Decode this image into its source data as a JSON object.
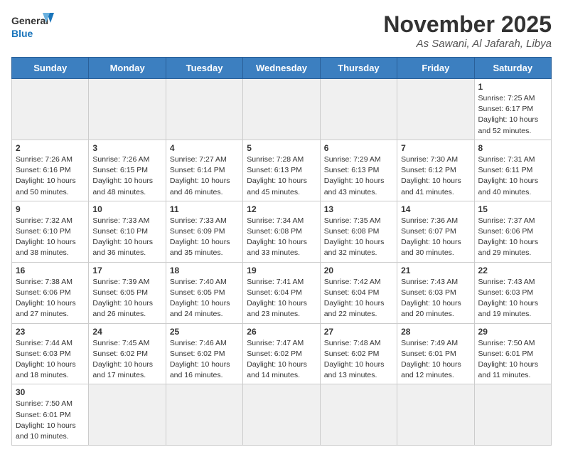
{
  "logo": {
    "general": "General",
    "blue": "Blue"
  },
  "title": "November 2025",
  "location": "As Sawani, Al Jafarah, Libya",
  "days_header": [
    "Sunday",
    "Monday",
    "Tuesday",
    "Wednesday",
    "Thursday",
    "Friday",
    "Saturday"
  ],
  "weeks": [
    [
      {
        "day": "",
        "info": ""
      },
      {
        "day": "",
        "info": ""
      },
      {
        "day": "",
        "info": ""
      },
      {
        "day": "",
        "info": ""
      },
      {
        "day": "",
        "info": ""
      },
      {
        "day": "",
        "info": ""
      },
      {
        "day": "1",
        "info": "Sunrise: 7:25 AM\nSunset: 6:17 PM\nDaylight: 10 hours and 52 minutes."
      }
    ],
    [
      {
        "day": "2",
        "info": "Sunrise: 7:26 AM\nSunset: 6:16 PM\nDaylight: 10 hours and 50 minutes."
      },
      {
        "day": "3",
        "info": "Sunrise: 7:26 AM\nSunset: 6:15 PM\nDaylight: 10 hours and 48 minutes."
      },
      {
        "day": "4",
        "info": "Sunrise: 7:27 AM\nSunset: 6:14 PM\nDaylight: 10 hours and 46 minutes."
      },
      {
        "day": "5",
        "info": "Sunrise: 7:28 AM\nSunset: 6:13 PM\nDaylight: 10 hours and 45 minutes."
      },
      {
        "day": "6",
        "info": "Sunrise: 7:29 AM\nSunset: 6:13 PM\nDaylight: 10 hours and 43 minutes."
      },
      {
        "day": "7",
        "info": "Sunrise: 7:30 AM\nSunset: 6:12 PM\nDaylight: 10 hours and 41 minutes."
      },
      {
        "day": "8",
        "info": "Sunrise: 7:31 AM\nSunset: 6:11 PM\nDaylight: 10 hours and 40 minutes."
      }
    ],
    [
      {
        "day": "9",
        "info": "Sunrise: 7:32 AM\nSunset: 6:10 PM\nDaylight: 10 hours and 38 minutes."
      },
      {
        "day": "10",
        "info": "Sunrise: 7:33 AM\nSunset: 6:10 PM\nDaylight: 10 hours and 36 minutes."
      },
      {
        "day": "11",
        "info": "Sunrise: 7:33 AM\nSunset: 6:09 PM\nDaylight: 10 hours and 35 minutes."
      },
      {
        "day": "12",
        "info": "Sunrise: 7:34 AM\nSunset: 6:08 PM\nDaylight: 10 hours and 33 minutes."
      },
      {
        "day": "13",
        "info": "Sunrise: 7:35 AM\nSunset: 6:08 PM\nDaylight: 10 hours and 32 minutes."
      },
      {
        "day": "14",
        "info": "Sunrise: 7:36 AM\nSunset: 6:07 PM\nDaylight: 10 hours and 30 minutes."
      },
      {
        "day": "15",
        "info": "Sunrise: 7:37 AM\nSunset: 6:06 PM\nDaylight: 10 hours and 29 minutes."
      }
    ],
    [
      {
        "day": "16",
        "info": "Sunrise: 7:38 AM\nSunset: 6:06 PM\nDaylight: 10 hours and 27 minutes."
      },
      {
        "day": "17",
        "info": "Sunrise: 7:39 AM\nSunset: 6:05 PM\nDaylight: 10 hours and 26 minutes."
      },
      {
        "day": "18",
        "info": "Sunrise: 7:40 AM\nSunset: 6:05 PM\nDaylight: 10 hours and 24 minutes."
      },
      {
        "day": "19",
        "info": "Sunrise: 7:41 AM\nSunset: 6:04 PM\nDaylight: 10 hours and 23 minutes."
      },
      {
        "day": "20",
        "info": "Sunrise: 7:42 AM\nSunset: 6:04 PM\nDaylight: 10 hours and 22 minutes."
      },
      {
        "day": "21",
        "info": "Sunrise: 7:43 AM\nSunset: 6:03 PM\nDaylight: 10 hours and 20 minutes."
      },
      {
        "day": "22",
        "info": "Sunrise: 7:43 AM\nSunset: 6:03 PM\nDaylight: 10 hours and 19 minutes."
      }
    ],
    [
      {
        "day": "23",
        "info": "Sunrise: 7:44 AM\nSunset: 6:03 PM\nDaylight: 10 hours and 18 minutes."
      },
      {
        "day": "24",
        "info": "Sunrise: 7:45 AM\nSunset: 6:02 PM\nDaylight: 10 hours and 17 minutes."
      },
      {
        "day": "25",
        "info": "Sunrise: 7:46 AM\nSunset: 6:02 PM\nDaylight: 10 hours and 16 minutes."
      },
      {
        "day": "26",
        "info": "Sunrise: 7:47 AM\nSunset: 6:02 PM\nDaylight: 10 hours and 14 minutes."
      },
      {
        "day": "27",
        "info": "Sunrise: 7:48 AM\nSunset: 6:02 PM\nDaylight: 10 hours and 13 minutes."
      },
      {
        "day": "28",
        "info": "Sunrise: 7:49 AM\nSunset: 6:01 PM\nDaylight: 10 hours and 12 minutes."
      },
      {
        "day": "29",
        "info": "Sunrise: 7:50 AM\nSunset: 6:01 PM\nDaylight: 10 hours and 11 minutes."
      }
    ],
    [
      {
        "day": "30",
        "info": "Sunrise: 7:50 AM\nSunset: 6:01 PM\nDaylight: 10 hours and 10 minutes."
      },
      {
        "day": "",
        "info": ""
      },
      {
        "day": "",
        "info": ""
      },
      {
        "day": "",
        "info": ""
      },
      {
        "day": "",
        "info": ""
      },
      {
        "day": "",
        "info": ""
      },
      {
        "day": "",
        "info": ""
      }
    ]
  ]
}
